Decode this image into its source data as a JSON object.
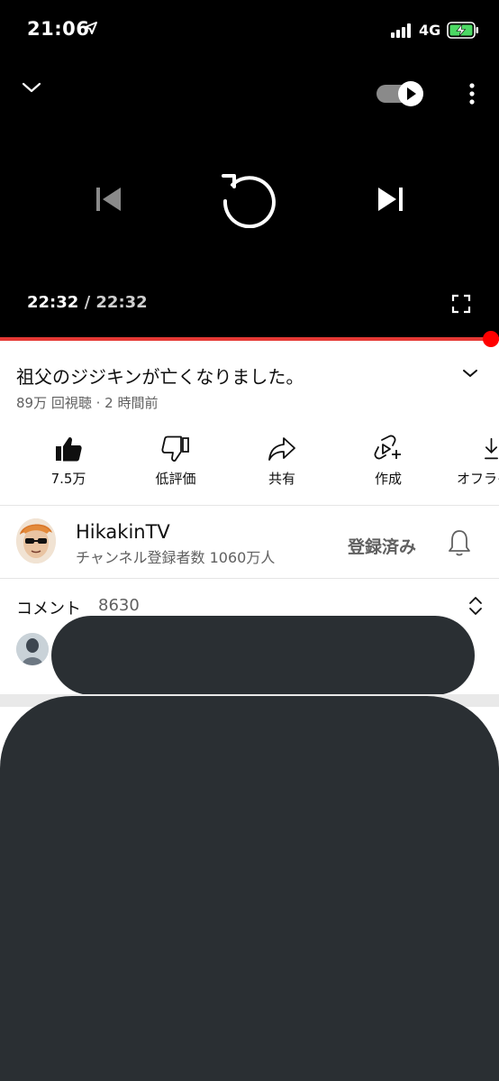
{
  "status_bar": {
    "time": "21:06",
    "network": "4G"
  },
  "player": {
    "current_time": "22:32",
    "separator": " / ",
    "duration": "22:32",
    "progress": 1.0,
    "autoplay_on": true,
    "accent_color": "#ff0000"
  },
  "video": {
    "title": "祖父のジジキンが亡くなりました。",
    "meta": "89万 回視聴 · 2 時間前"
  },
  "actions": [
    {
      "label": "7.5万",
      "icon": "thumbs-up-icon"
    },
    {
      "label": "低評価",
      "icon": "thumbs-down-icon"
    },
    {
      "label": "共有",
      "icon": "share-icon"
    },
    {
      "label": "作成",
      "icon": "create-icon"
    },
    {
      "label": "オフライ",
      "icon": "download-icon"
    }
  ],
  "channel": {
    "name": "HikakinTV",
    "subscribers": "チャンネル登録者数 1060万人",
    "subscribe_label": "登録済み"
  },
  "comments": {
    "label": "コメント",
    "count": "8630"
  }
}
